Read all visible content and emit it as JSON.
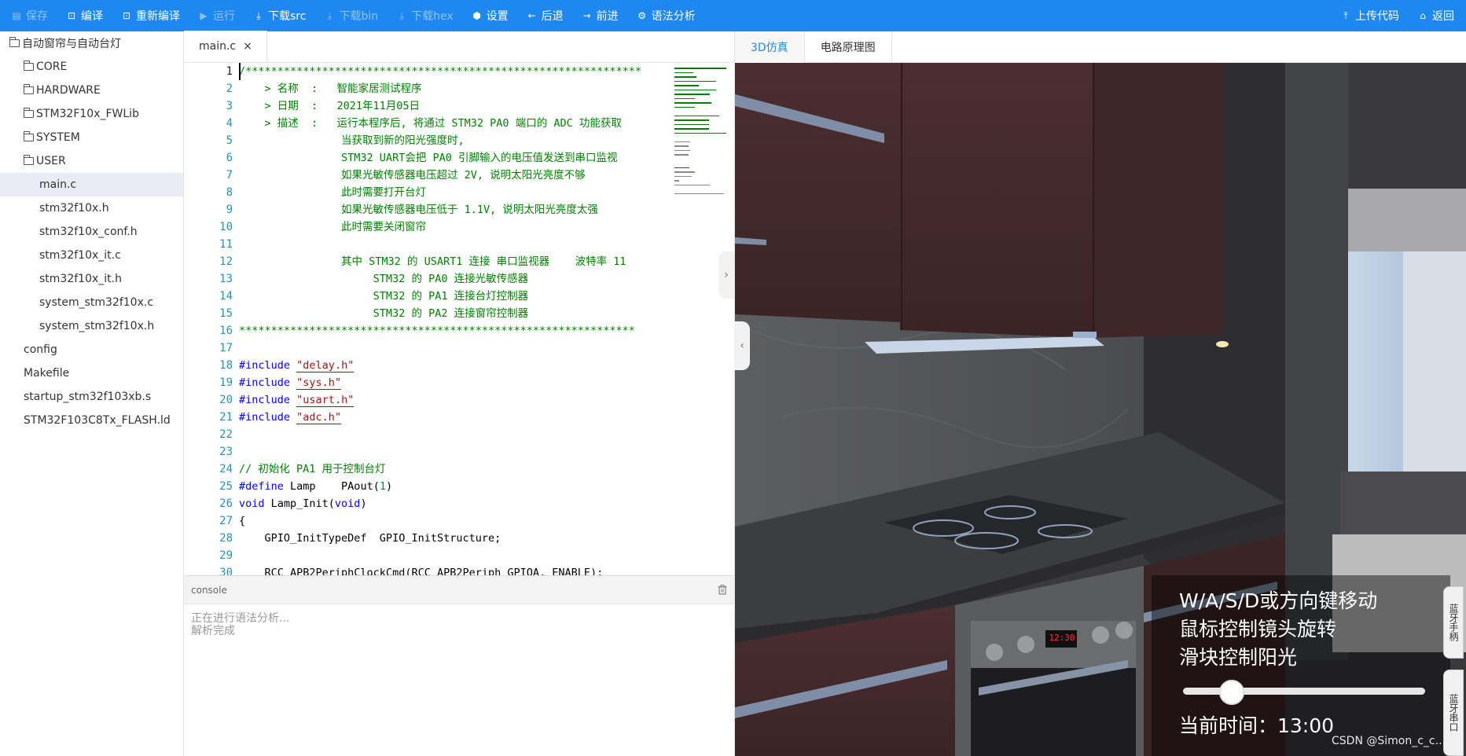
{
  "toolbar": {
    "left": [
      {
        "label": "保存",
        "icon": "save-icon",
        "disabled": true
      },
      {
        "label": "编译",
        "icon": "compile-icon",
        "disabled": false
      },
      {
        "label": "重新编译",
        "icon": "recompile-icon",
        "disabled": false
      },
      {
        "label": "运行",
        "icon": "run-icon",
        "disabled": true
      },
      {
        "label": "下载src",
        "icon": "download-icon",
        "disabled": false
      },
      {
        "label": "下载bin",
        "icon": "download-icon",
        "disabled": true
      },
      {
        "label": "下载hex",
        "icon": "download-icon",
        "disabled": true
      },
      {
        "label": "设置",
        "icon": "settings-icon",
        "disabled": false
      },
      {
        "label": "后退",
        "icon": "arrow-left-icon",
        "disabled": false
      },
      {
        "label": "前进",
        "icon": "arrow-right-icon",
        "disabled": false
      },
      {
        "label": "语法分析",
        "icon": "gear-icon",
        "disabled": false
      }
    ],
    "right": [
      {
        "label": "上传代码",
        "icon": "upload-icon"
      },
      {
        "label": "返回",
        "icon": "home-icon"
      }
    ]
  },
  "filetree": {
    "root": "自动窗帘与自动台灯",
    "items": [
      {
        "label": "CORE",
        "type": "folder",
        "depth": 1
      },
      {
        "label": "HARDWARE",
        "type": "folder",
        "depth": 1
      },
      {
        "label": "STM32F10x_FWLib",
        "type": "folder",
        "depth": 1
      },
      {
        "label": "SYSTEM",
        "type": "folder",
        "depth": 1
      },
      {
        "label": "USER",
        "type": "folder",
        "depth": 1
      },
      {
        "label": "main.c",
        "type": "file",
        "depth": 2,
        "active": true
      },
      {
        "label": "stm32f10x.h",
        "type": "file",
        "depth": 2
      },
      {
        "label": "stm32f10x_conf.h",
        "type": "file",
        "depth": 2
      },
      {
        "label": "stm32f10x_it.c",
        "type": "file",
        "depth": 2
      },
      {
        "label": "stm32f10x_it.h",
        "type": "file",
        "depth": 2
      },
      {
        "label": "system_stm32f10x.c",
        "type": "file",
        "depth": 2
      },
      {
        "label": "system_stm32f10x.h",
        "type": "file",
        "depth": 2
      },
      {
        "label": "config",
        "type": "file",
        "depth": 1
      },
      {
        "label": "Makefile",
        "type": "file",
        "depth": 1
      },
      {
        "label": "startup_stm32f103xb.s",
        "type": "file",
        "depth": 1
      },
      {
        "label": "STM32F103C8Tx_FLASH.ld",
        "type": "file",
        "depth": 1
      }
    ]
  },
  "editor": {
    "tab": "main.c",
    "close": "×",
    "lines": [
      {
        "n": "1",
        "html": "<span class='c-cm'>/**************************************************************</span>"
      },
      {
        "n": "2",
        "html": "<span class='c-cm'>    &gt; 名称  :   智能家居测试程序</span>"
      },
      {
        "n": "3",
        "html": "<span class='c-cm'>    &gt; 日期  :   2021年11月05日</span>"
      },
      {
        "n": "4",
        "html": "<span class='c-cm'>    &gt; 描述  :   运行本程序后, 将通过 STM32 PA0 端口的 ADC 功能获取</span>"
      },
      {
        "n": "5",
        "html": "<span class='c-cm'>                当获取到新的阳光强度时,</span>"
      },
      {
        "n": "6",
        "html": "<span class='c-cm'>                STM32 UART会把 PA0 引脚输入的电压值发送到串口监视</span>"
      },
      {
        "n": "7",
        "html": "<span class='c-cm'>                如果光敏传感器电压超过 2V, 说明太阳光亮度不够</span>"
      },
      {
        "n": "8",
        "html": "<span class='c-cm'>                此时需要打开台灯</span>"
      },
      {
        "n": "9",
        "html": "<span class='c-cm'>                如果光敏传感器电压低于 1.1V, 说明太阳光亮度太强</span>"
      },
      {
        "n": "10",
        "html": "<span class='c-cm'>                此时需要关闭窗帘</span>"
      },
      {
        "n": "11",
        "html": ""
      },
      {
        "n": "12",
        "html": "<span class='c-cm'>                其中 STM32 的 USART1 连接 串口监视器    波特率 11</span>"
      },
      {
        "n": "13",
        "html": "<span class='c-cm'>                     STM32 的 PA0 连接光敏传感器</span>"
      },
      {
        "n": "14",
        "html": "<span class='c-cm'>                     STM32 的 PA1 连接台灯控制器</span>"
      },
      {
        "n": "15",
        "html": "<span class='c-cm'>                     STM32 的 PA2 连接窗帘控制器</span>"
      },
      {
        "n": "16",
        "html": "<span class='c-cm'>**************************************************************</span>"
      },
      {
        "n": "17",
        "html": ""
      },
      {
        "n": "18",
        "html": "<span class='c-pp'>#include</span> <span class='c-str'>\"delay.h\"</span>"
      },
      {
        "n": "19",
        "html": "<span class='c-pp'>#include</span> <span class='c-str'>\"sys.h\"</span>"
      },
      {
        "n": "20",
        "html": "<span class='c-pp'>#include</span> <span class='c-str'>\"usart.h\"</span>"
      },
      {
        "n": "21",
        "html": "<span class='c-pp'>#include</span> <span class='c-str'>\"adc.h\"</span>"
      },
      {
        "n": "22",
        "html": ""
      },
      {
        "n": "23",
        "html": ""
      },
      {
        "n": "24",
        "html": "<span class='c-cm'>// 初始化 PA1 用于控制台灯</span>"
      },
      {
        "n": "25",
        "html": "<span class='c-pp'>#define</span> Lamp    PAout(<span class='c-num'>1</span>)"
      },
      {
        "n": "26",
        "html": "<span class='c-kw'>void</span> Lamp_Init(<span class='c-kw'>void</span>)"
      },
      {
        "n": "27",
        "html": "{"
      },
      {
        "n": "28",
        "html": "    GPIO_InitTypeDef  GPIO_InitStructure;"
      },
      {
        "n": "29",
        "html": ""
      },
      {
        "n": "30",
        "html": "    RCC_APB2PeriphClockCmd(RCC_APB2Periph_GPIOA, ENABLE);"
      }
    ]
  },
  "console": {
    "title": "console",
    "lines": [
      "正在进行语法分析...",
      "解析完成"
    ]
  },
  "right": {
    "tabs": [
      {
        "label": "3D仿真",
        "active": true
      },
      {
        "label": "电路原理图",
        "active": false
      }
    ],
    "overlay": {
      "line1": "W/A/S/D或方向键移动",
      "line2": "鼠标控制镜头旋转",
      "line3": "滑块控制阳光",
      "time": "当前时间：13:00"
    },
    "oven_display": "12:30",
    "side_buttons": [
      "蓝牙手柄",
      "蓝牙串口"
    ],
    "watermark": "CSDN @Simon_c_c..."
  },
  "colors": {
    "accent": "#1e87f0",
    "comment": "#008000",
    "keyword": "#0000ff",
    "string": "#a31515"
  }
}
